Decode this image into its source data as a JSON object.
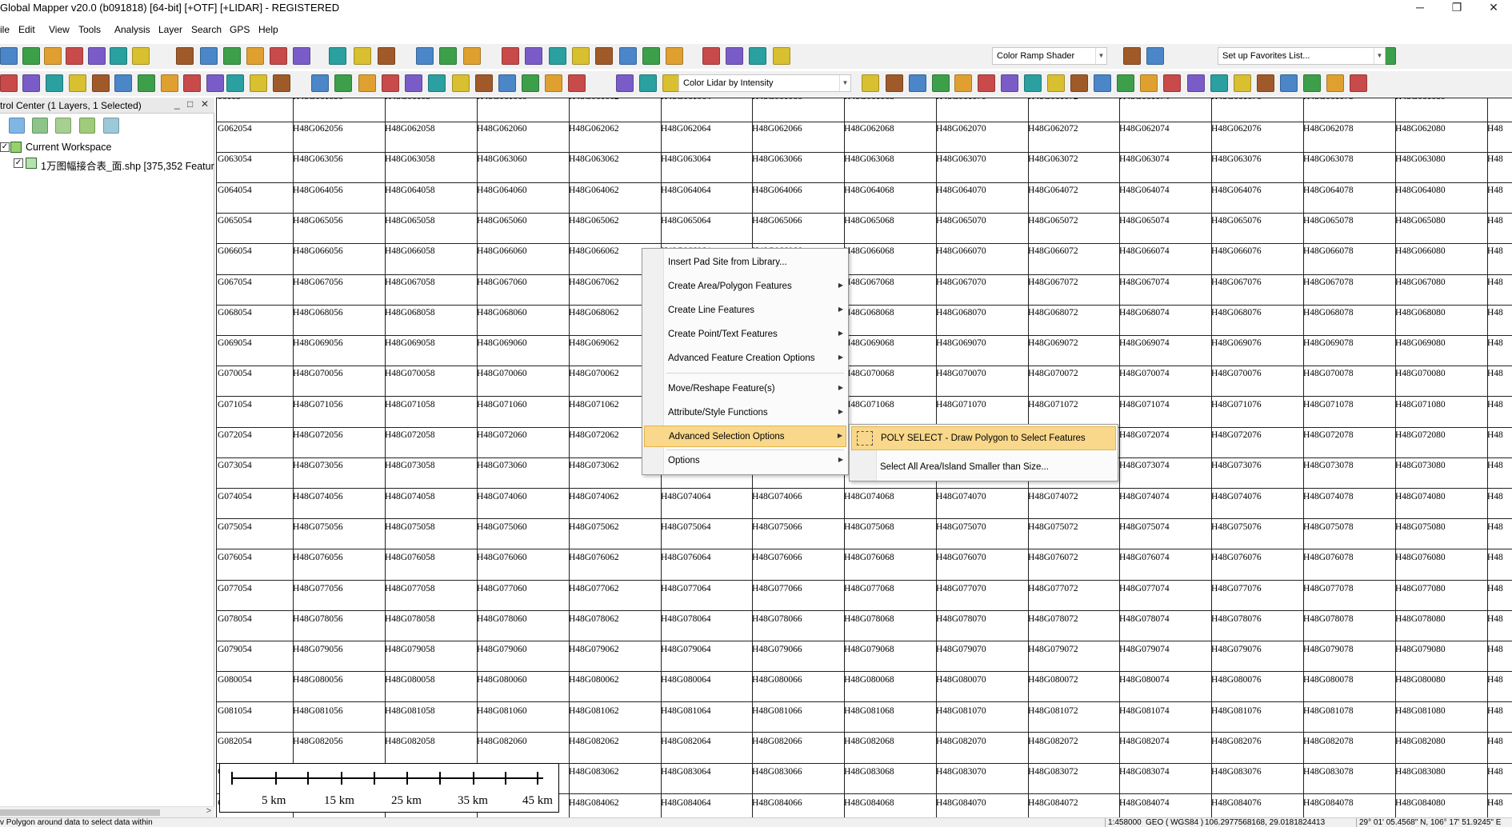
{
  "window": {
    "title": "Global Mapper v20.0 (b091818) [64-bit] [+OTF] [+LIDAR] - REGISTERED",
    "minimize": "─",
    "restore": "❐",
    "close": "✕"
  },
  "menu": [
    "ile",
    "Edit",
    "View",
    "Tools",
    "Analysis",
    "Layer",
    "Search",
    "GPS",
    "Help"
  ],
  "toolbar1": {
    "combo_shader": "Color Ramp Shader",
    "combo_favorites": "Set up Favorites List...",
    "icons": [
      "open-data-icon",
      "globe-icon",
      "save-icon",
      "export-icon",
      "config-icon",
      "control-center-icon",
      "overview-icon",
      "zoom-icon",
      "pan-icon",
      "zoom-in-icon",
      "zoom-out-icon",
      "back-icon",
      "home-icon",
      "digitizer-icon",
      "select-icon",
      "delete-icon",
      "measure-icon",
      "info-icon",
      "path-profile-icon",
      "3d-view-icon",
      "terrain-icon",
      "contour-icon",
      "watershed-icon",
      "view-shed-icon",
      "cut-fill-icon",
      "compare-icon",
      "lidar-icon",
      "layout-icon",
      "map-icon",
      "hillshade-icon",
      "daylight-icon",
      "globe-web-icon",
      "star-icon"
    ]
  },
  "toolbar2": {
    "combo_lidar": "Color Lidar by Intensity"
  },
  "control_center": {
    "title": "trol Center (1 Layers, 1 Selected)",
    "btn_min": "_",
    "btn_max": "□",
    "btn_close": "✕",
    "workspace": "Current Workspace",
    "layer": "1万图幅接合表_面.shp [375,352 Featur"
  },
  "map": {
    "col_x": [
      270,
      366,
      481,
      596,
      711,
      826,
      940,
      1055,
      1170,
      1285,
      1399,
      1514,
      1629,
      1744,
      1859
    ],
    "row_tops": [
      122,
      152,
      190,
      228,
      266,
      304,
      343,
      381,
      419,
      457,
      495,
      534,
      572,
      610,
      648,
      686,
      725,
      763,
      801,
      839,
      877,
      915,
      954,
      992
    ],
    "first_label_row_y": 161,
    "row_step": 38.3,
    "rows": [
      "062",
      "063",
      "064",
      "065",
      "066",
      "067",
      "068",
      "069",
      "070",
      "071",
      "072",
      "073",
      "074",
      "075",
      "076",
      "077",
      "078",
      "079",
      "080",
      "081",
      "082",
      "083",
      "084"
    ],
    "partial_first_col": true
  },
  "scalebar": {
    "labels": [
      "5 km",
      "15 km",
      "25 km",
      "35 km",
      "45 km"
    ]
  },
  "context_menu": {
    "items": [
      {
        "label": "Insert Pad Site from Library...",
        "submenu": false
      },
      {
        "label": "Create Area/Polygon Features",
        "submenu": true
      },
      {
        "label": "Create Line Features",
        "submenu": true
      },
      {
        "label": "Create Point/Text Features",
        "submenu": true
      },
      {
        "label": "Advanced Feature Creation Options",
        "submenu": true
      },
      {
        "label": "Move/Reshape Feature(s)",
        "submenu": true
      },
      {
        "label": "Attribute/Style Functions",
        "submenu": true
      },
      {
        "label": "Advanced Selection Options",
        "submenu": true,
        "active": true
      },
      {
        "label": "Options",
        "submenu": true
      }
    ],
    "arrow": "▶"
  },
  "submenu": {
    "items": [
      {
        "label": "POLY SELECT - Draw Polygon to Select Features",
        "active": true
      },
      {
        "label": "Select All Area/Island Smaller than Size..."
      }
    ]
  },
  "status": {
    "hint": "v Polygon around data to select data within",
    "scale": "1:458000",
    "projection": "GEO ( WGS84 )",
    "coords": "106.2977568168, 29.0181824413",
    "dms": "29° 01' 05.4568\" N, 106° 17' 51.9245\" E"
  },
  "colors": {
    "active_highlight": "#f9d88b",
    "toolbar_bg": "#f1f1f1"
  }
}
